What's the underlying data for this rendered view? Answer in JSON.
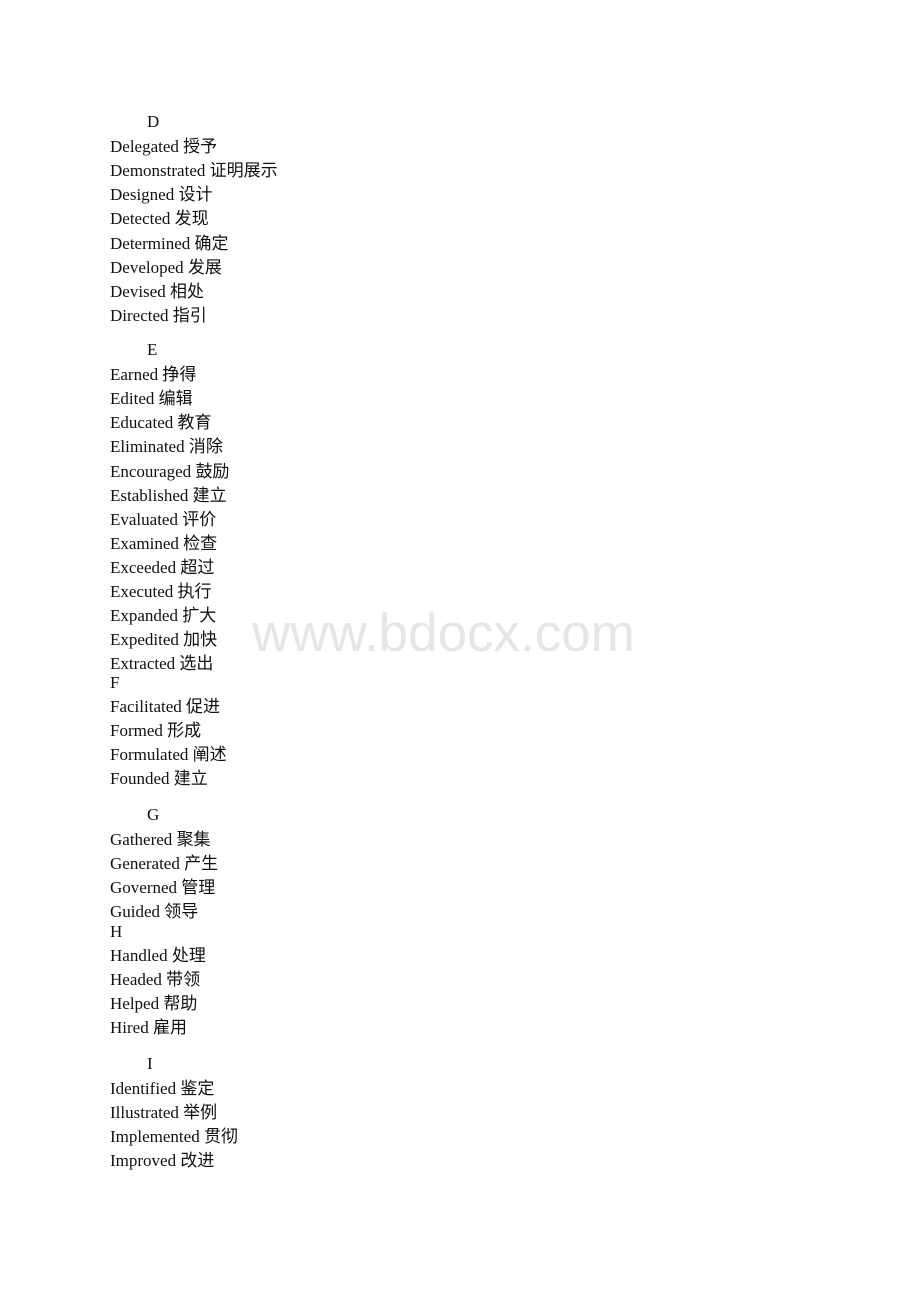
{
  "watermark": "www.bdocx.com",
  "sections": [
    {
      "letter": "D",
      "indented": true,
      "entries": [
        {
          "en": "Delegated",
          "zh": "授予"
        },
        {
          "en": "Demonstrated",
          "zh": "证明展示"
        },
        {
          "en": "Designed",
          "zh": "设计"
        },
        {
          "en": "Detected",
          "zh": "发现"
        },
        {
          "en": "Determined",
          "zh": "确定"
        },
        {
          "en": "Developed",
          "zh": "发展"
        },
        {
          "en": "Devised",
          "zh": "相处"
        },
        {
          "en": "Directed",
          "zh": "指引"
        }
      ]
    },
    {
      "letter": "E",
      "indented": true,
      "entries": [
        {
          "en": "Earned",
          "zh": "挣得"
        },
        {
          "en": "Edited",
          "zh": "编辑"
        },
        {
          "en": "Educated",
          "zh": "教育"
        },
        {
          "en": "Eliminated",
          "zh": "消除"
        },
        {
          "en": "Encouraged",
          "zh": "鼓励"
        },
        {
          "en": "Established",
          "zh": "建立"
        },
        {
          "en": "Evaluated",
          "zh": "评价"
        },
        {
          "en": "Examined",
          "zh": "检查"
        },
        {
          "en": "Exceeded",
          "zh": "超过"
        },
        {
          "en": "Executed",
          "zh": "执行"
        },
        {
          "en": "Expanded",
          "zh": "扩大"
        },
        {
          "en": "Expedited",
          "zh": "加快"
        },
        {
          "en": "Extracted",
          "zh": "选出"
        }
      ]
    },
    {
      "letter": "F",
      "indented": false,
      "entries": [
        {
          "en": "Facilitated",
          "zh": "促进"
        },
        {
          "en": "Formed",
          "zh": "形成"
        },
        {
          "en": "Formulated",
          "zh": "阐述"
        },
        {
          "en": "Founded",
          "zh": "建立"
        }
      ]
    },
    {
      "letter": "G",
      "indented": true,
      "entries": [
        {
          "en": "Gathered",
          "zh": "聚集"
        },
        {
          "en": "Generated",
          "zh": "产生"
        },
        {
          "en": "Governed",
          "zh": "管理"
        },
        {
          "en": "Guided",
          "zh": "领导"
        }
      ]
    },
    {
      "letter": "H",
      "indented": false,
      "entries": [
        {
          "en": "Handled",
          "zh": "处理"
        },
        {
          "en": "Headed",
          "zh": "带领"
        },
        {
          "en": "Helped",
          "zh": "帮助"
        },
        {
          "en": "Hired",
          "zh": "雇用"
        }
      ]
    },
    {
      "letter": "I",
      "indented": true,
      "entries": [
        {
          "en": "Identified",
          "zh": "鉴定"
        },
        {
          "en": "Illustrated",
          "zh": "举例"
        },
        {
          "en": "Implemented",
          "zh": "贯彻"
        },
        {
          "en": "Improved",
          "zh": "改进"
        }
      ]
    }
  ]
}
